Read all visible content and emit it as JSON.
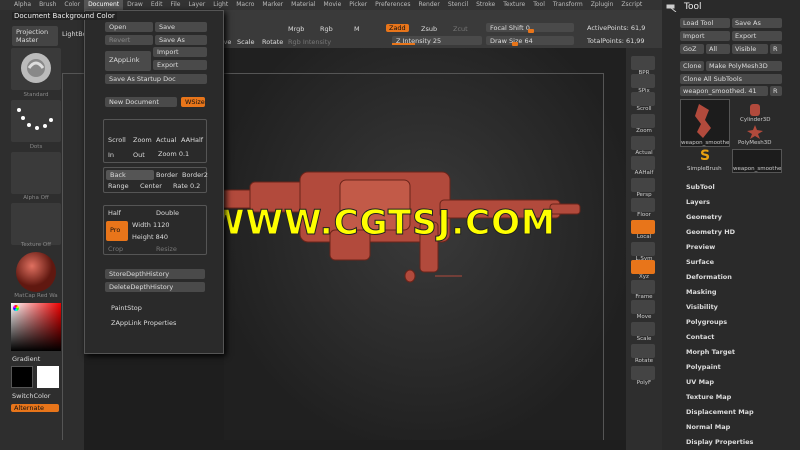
{
  "menu": [
    "Alpha",
    "Brush",
    "Color",
    "Document",
    "Draw",
    "Edit",
    "File",
    "Layer",
    "Light",
    "Macro",
    "Marker",
    "Material",
    "Movie",
    "Picker",
    "Preferences",
    "Render",
    "Stencil",
    "Stroke",
    "Texture",
    "Tool",
    "Transform",
    "Zplugin",
    "Zscript"
  ],
  "menu_active": 3,
  "tooltip": "Document Background Color",
  "toolbar": {
    "move": "Move",
    "scale": "Scale",
    "rotate": "Rotate",
    "mrgb": "Mrgb",
    "rgb": "Rgb",
    "m": "M",
    "zadd": "Zadd",
    "zsub": "Zsub",
    "zcut": "Zcut",
    "rgb_intensity": "Rgb Intensity",
    "z_intensity_label": "Z Intensity",
    "z_intensity": "25",
    "focal_shift_label": "Focal Shift",
    "focal_shift": "0",
    "draw_size_label": "Draw Size",
    "draw_size": "64",
    "active_points": "ActivePoints: 61,9",
    "total_points": "TotalPoints: 61,99"
  },
  "left": {
    "projection_master": "Projection Master",
    "lightbox": "LightBox",
    "standard": "Standard",
    "dots": "Dots",
    "alpha_off": "Alpha Off",
    "texture_off": "Texture Off",
    "matcap": "MatCap Red Wa",
    "gradient": "Gradient",
    "switchcolor": "SwitchColor",
    "alternate": "Alternate"
  },
  "document": {
    "open": "Open",
    "save": "Save",
    "revert": "Revert",
    "save_as": "Save As",
    "zapplink": "ZAppLink",
    "import": "Import",
    "export": "Export",
    "save_startup": "Save As Startup Doc",
    "new_document": "New Document",
    "wsize": "WSize",
    "scroll": "Scroll",
    "zoom": "Zoom",
    "actual": "Actual",
    "aahalf": "AAHalf",
    "in": "In",
    "out": "Out",
    "zoom_label": "Zoom",
    "zoom_val": "0.1",
    "back": "Back",
    "border": "Border",
    "border2": "Border2",
    "range": "Range",
    "center": "Center",
    "rate": "Rate",
    "rate_val": "0.2",
    "half": "Half",
    "double": "Double",
    "pro": "Pro",
    "width": "Width",
    "width_val": "1120",
    "height": "Height",
    "height_val": "840",
    "crop": "Crop",
    "resize": "Resize",
    "store_depth": "StoreDepthHistory",
    "delete_depth": "DeleteDepthHistory",
    "paintstop": "PaintStop",
    "zapplink_props": "ZAppLink Properties"
  },
  "watermark": "WWW.CGTSJ.COM",
  "shelf": [
    "BPR",
    "SPix",
    "Scroll",
    "Zoom",
    "Actual",
    "AAHalf",
    "Persp",
    "Floor",
    "Local",
    "L.Sym",
    "Xyz",
    "Frame",
    "Move",
    "Scale",
    "Rotate",
    "PolyF"
  ],
  "tool": {
    "title": "Tool",
    "load_tool": "Load Tool",
    "save_as": "Save As",
    "import": "Import",
    "export": "Export",
    "goz": "GoZ",
    "all": "All",
    "visible": "Visible",
    "r": "R",
    "clone": "Clone",
    "make_polymesh": "Make PolyMesh3D",
    "clone_all": "Clone All SubTools",
    "current_tool": "weapon_smoothed",
    "current_tool_val": "41",
    "thumbs": [
      "weapon_smoothe",
      "Cylinder3D",
      "PolyMesh3D",
      "SimpleBrush",
      "weapon_smoothe"
    ],
    "items": [
      "SubTool",
      "Layers",
      "Geometry",
      "Geometry HD",
      "Preview",
      "Surface",
      "Deformation",
      "Masking",
      "Visibility",
      "Polygroups",
      "Contact",
      "Morph Target",
      "Polypaint",
      "UV Map",
      "Texture Map",
      "Displacement Map",
      "Normal Map",
      "Display Properties"
    ]
  },
  "colors": {
    "accent": "#e8751a",
    "watermark": "#ffff00",
    "model": "#b24a3c"
  }
}
